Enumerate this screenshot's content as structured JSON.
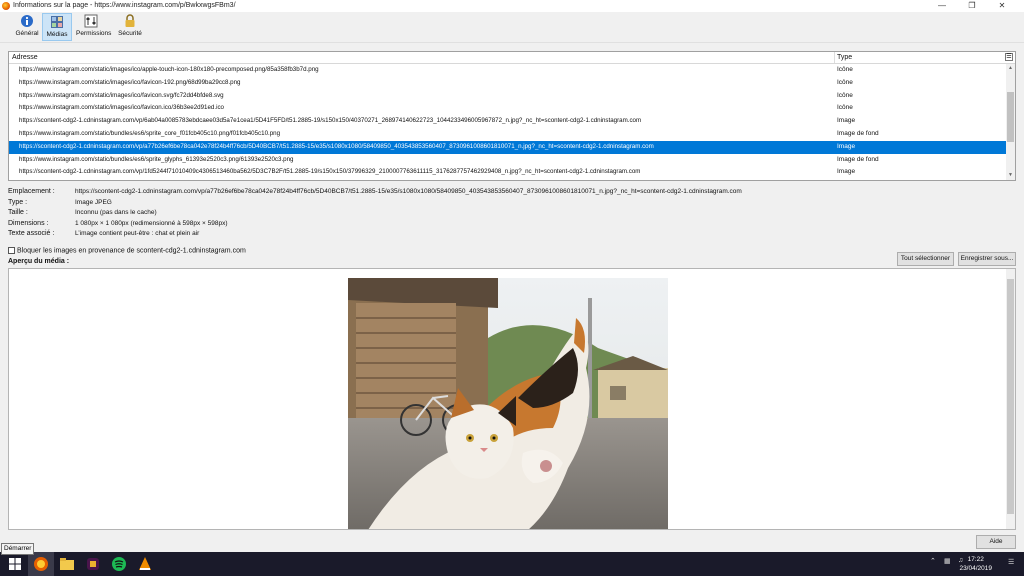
{
  "window": {
    "title": "Informations sur la page - https://www.instagram.com/p/BwkxwgsFBm3/"
  },
  "toolbar": {
    "items": [
      {
        "label": "Général",
        "icon": "info-icon"
      },
      {
        "label": "Médias",
        "icon": "media-icon"
      },
      {
        "label": "Permissions",
        "icon": "permissions-icon"
      },
      {
        "label": "Sécurité",
        "icon": "lock-icon"
      }
    ]
  },
  "table": {
    "headers": {
      "address": "Adresse",
      "type": "Type"
    },
    "rows": [
      {
        "address": "https://www.instagram.com/static/images/ico/apple-touch-icon-180x180-precomposed.png/85a358fb3b7d.png",
        "type": "Icône"
      },
      {
        "address": "https://www.instagram.com/static/images/ico/favicon-192.png/68d99ba29cc8.png",
        "type": "Icône"
      },
      {
        "address": "https://www.instagram.com/static/images/ico/favicon.svg/fc72dd4bfde8.svg",
        "type": "Icône"
      },
      {
        "address": "https://www.instagram.com/static/images/ico/favicon.ico/36b3ee2d91ed.ico",
        "type": "Icône"
      },
      {
        "address": "https://scontent-cdg2-1.cdninstagram.com/vp/6ab04a0085783ebdcaee03d5a7e1cea1/5D41F5FD/t51.2885-19/s150x150/40370271_268974140622723_1044233496005967872_n.jpg?_nc_ht=scontent-cdg2-1.cdninstagram.com",
        "type": "Image"
      },
      {
        "address": "https://www.instagram.com/static/bundles/es6/sprite_core_f01fcb405c10.png/f01fcb405c10.png",
        "type": "Image de fond"
      },
      {
        "address": "https://scontent-cdg2-1.cdninstagram.com/vp/a77b26ef6be78ca042e78f24b4ff76cb/5D40BCB7/t51.2885-15/e35/s1080x1080/58409850_403543853560407_8730961008601810071_n.jpg?_nc_ht=scontent-cdg2-1.cdninstagram.com",
        "type": "Image"
      },
      {
        "address": "https://www.instagram.com/static/bundles/es6/sprite_glyphs_61393e2520c3.png/61393e2520c3.png",
        "type": "Image de fond"
      },
      {
        "address": "https://scontent-cdg2-1.cdninstagram.com/vp/1fd5244f71010409c4306513460ba562/5D3C7B2F/t51.2885-19/s150x150/37996329_2100007763611115_3176287757462929408_n.jpg?_nc_ht=scontent-cdg2-1.cdninstagram.com",
        "type": "Image"
      }
    ],
    "selected_index": 6
  },
  "properties": {
    "location_label": "Emplacement :",
    "location_value": "https://scontent-cdg2-1.cdninstagram.com/vp/a77b26ef6be78ca042e78f24b4ff76cb/5D40BCB7/t51.2885-15/e35/s1080x1080/58409850_403543853560407_8730961008601810071_n.jpg?_nc_ht=scontent-cdg2-1.cdninstagram.com",
    "type_label": "Type :",
    "type_value": "Image JPEG",
    "size_label": "Taille :",
    "size_value": "Inconnu (pas dans le cache)",
    "dimensions_label": "Dimensions :",
    "dimensions_value": "1 080px × 1 080px (redimensionné à 598px × 598px)",
    "alt_label": "Texte associé :",
    "alt_value": "L’image contient peut-être : chat et plein air"
  },
  "block_images": {
    "label": "Bloquer les images en provenance de scontent-cdg2-1.cdninstagram.com",
    "checked": false
  },
  "preview": {
    "label": "Aperçu du média :"
  },
  "buttons": {
    "select_all": "Tout sélectionner",
    "save_as": "Enregistrer sous...",
    "help": "Aide"
  },
  "taskbar": {
    "tooltip": "Démarrer",
    "time": "17:22",
    "date": "23/04/2019"
  },
  "colors": {
    "selection": "#0078d7",
    "taskbar": "#1a1a2a"
  }
}
